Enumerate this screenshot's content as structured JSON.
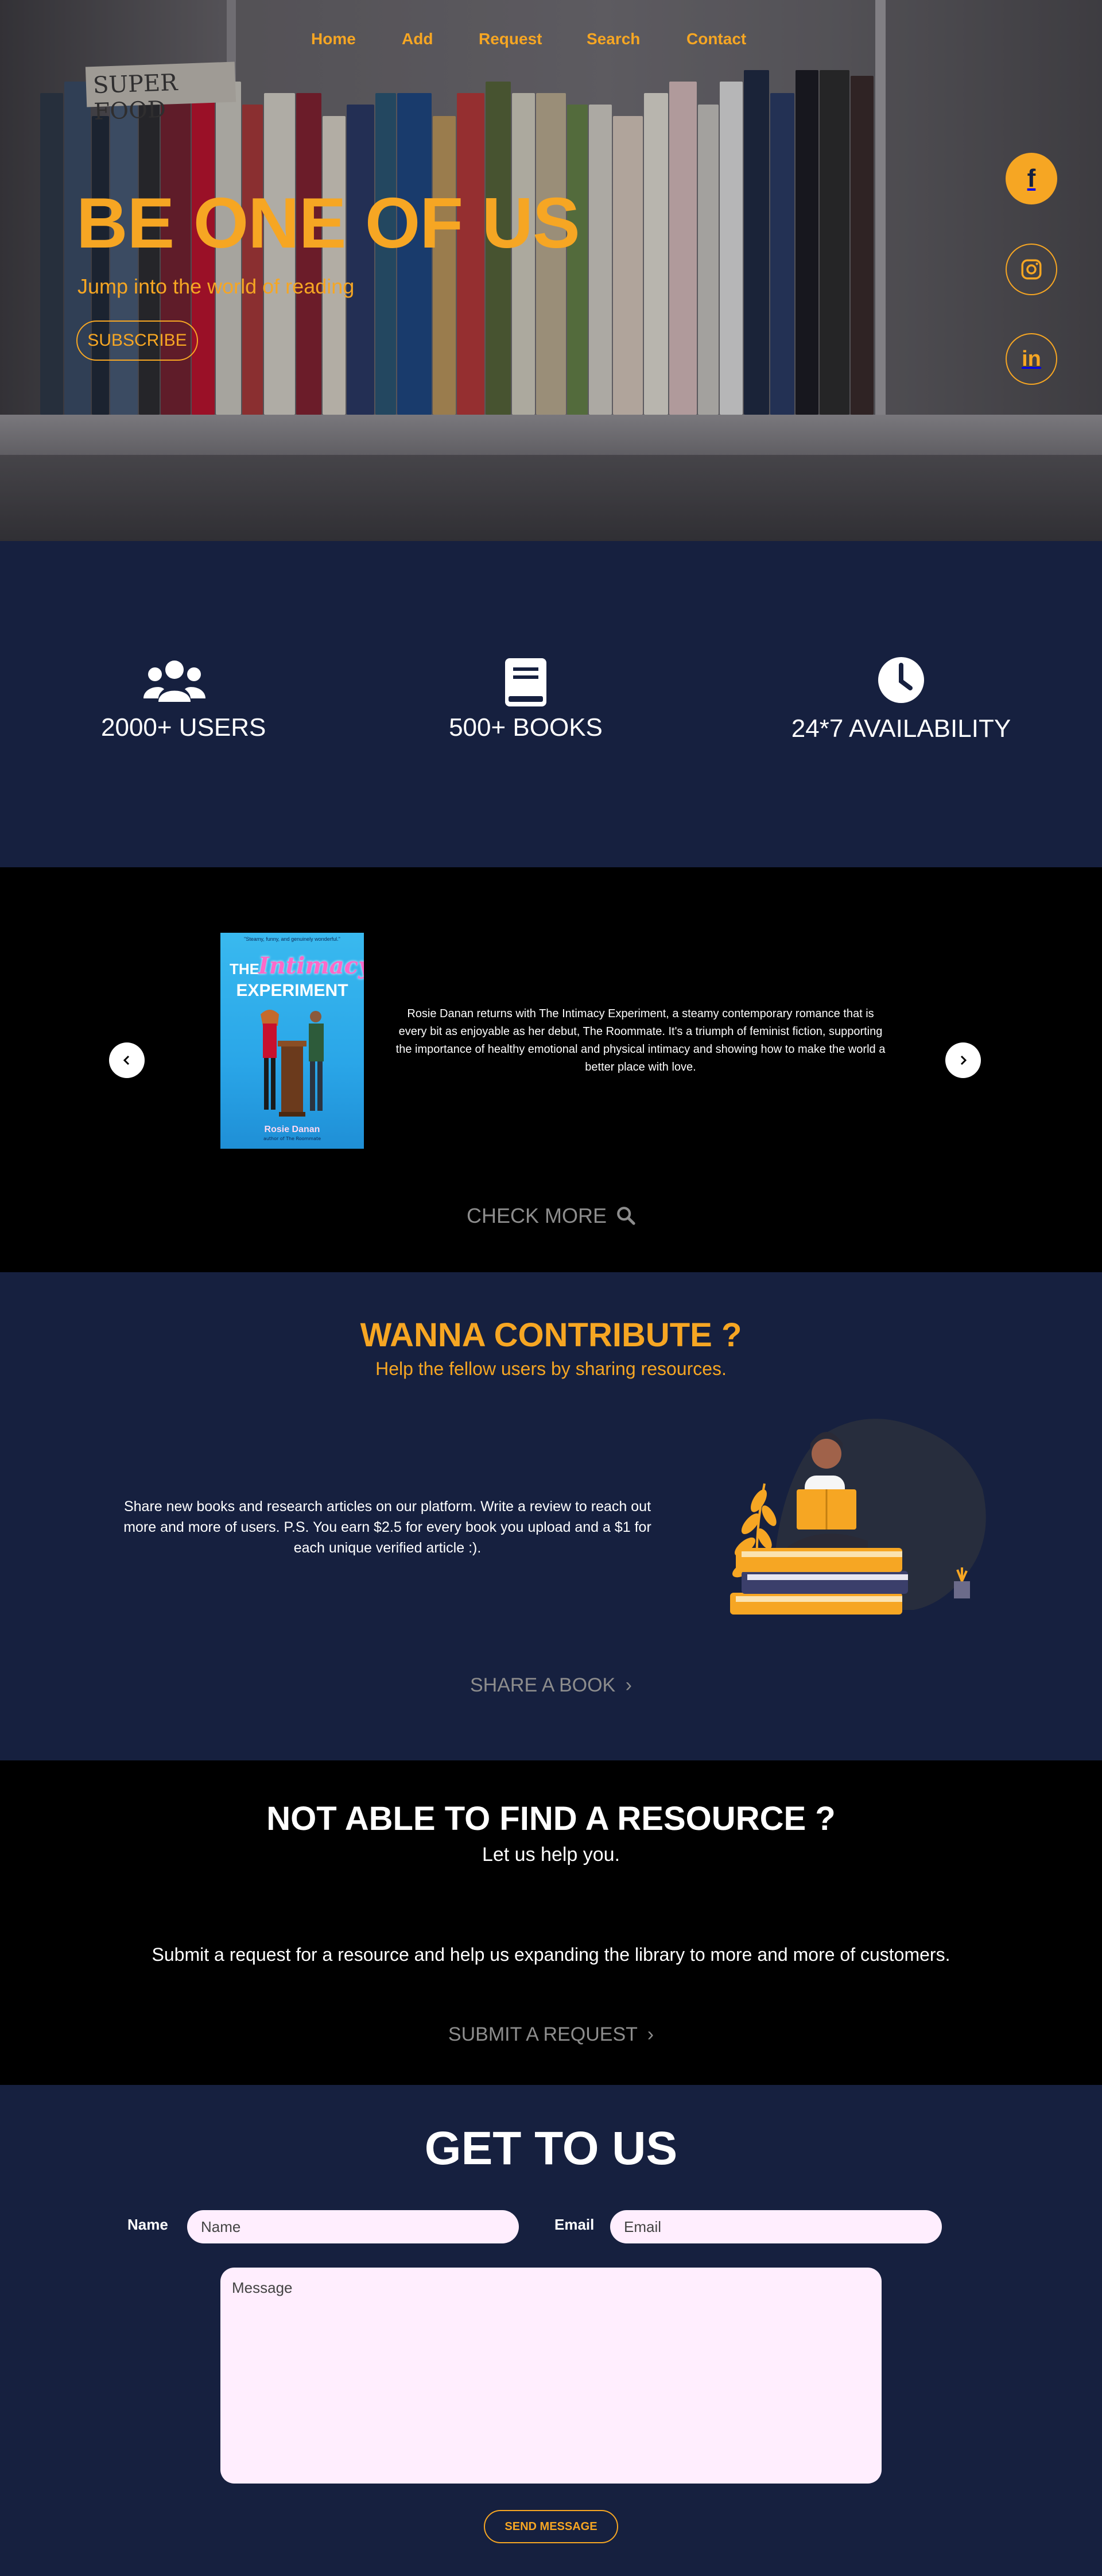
{
  "nav": {
    "items": [
      "Home",
      "Add",
      "Request",
      "Search",
      "Contact"
    ]
  },
  "hero": {
    "title": "BE ONE OF US",
    "subtitle": "Jump into the world of reading",
    "subscribe_label": "SUBSCRIBE",
    "cover_text": "SUPER FOOD"
  },
  "social": {
    "facebook": "f",
    "instagram": "instagram-icon",
    "linkedin": "in"
  },
  "stats": [
    {
      "icon": "users-icon",
      "label": "2000+ USERS"
    },
    {
      "icon": "book-icon",
      "label": "500+ BOOKS"
    },
    {
      "icon": "clock-icon",
      "label": "24*7 AVAILABILITY"
    }
  ],
  "carousel": {
    "cover": {
      "top_text": "\"Steamy, funny, and genuinely wonderful.\"",
      "the": "THE",
      "title_script": "Intimacy",
      "title_main": "EXPERIMENT",
      "author": "Rosie Danan",
      "author_sub": "author of The Roommate"
    },
    "description": "Rosie Danan returns with The Intimacy Experiment, a steamy contemporary romance that is every bit as enjoyable as her debut, The Roommate. It's a triumph of feminist fiction, supporting the importance of healthy emotional and physical intimacy and showing how to make the world a better place with love.",
    "check_more_label": "CHECK MORE"
  },
  "contribute": {
    "title": "WANNA CONTRIBUTE ?",
    "subtitle": "Help the fellow users by sharing resources.",
    "text": "Share new books and research articles on our platform. Write a review to reach out more and more of users. P.S. You earn $2.5 for every book you upload and a $1 for each unique verified article :).",
    "share_label": "SHARE A BOOK",
    "share_chevron": "›"
  },
  "request": {
    "title": "NOT ABLE TO FIND A RESOURCE ?",
    "subtitle": "Let us help you.",
    "text": "Submit a request for a resource and help us expanding the library to more and more of customers.",
    "submit_label": "SUBMIT A REQUEST",
    "submit_chevron": "›"
  },
  "contact": {
    "title": "GET TO US",
    "name_label": "Name",
    "name_placeholder": "Name",
    "email_label": "Email",
    "email_placeholder": "Email",
    "message_placeholder": "Message",
    "send_label": "SEND MESSAGE"
  },
  "colors": {
    "accent": "#f6a623",
    "navy": "#16203f",
    "black": "#000000"
  }
}
